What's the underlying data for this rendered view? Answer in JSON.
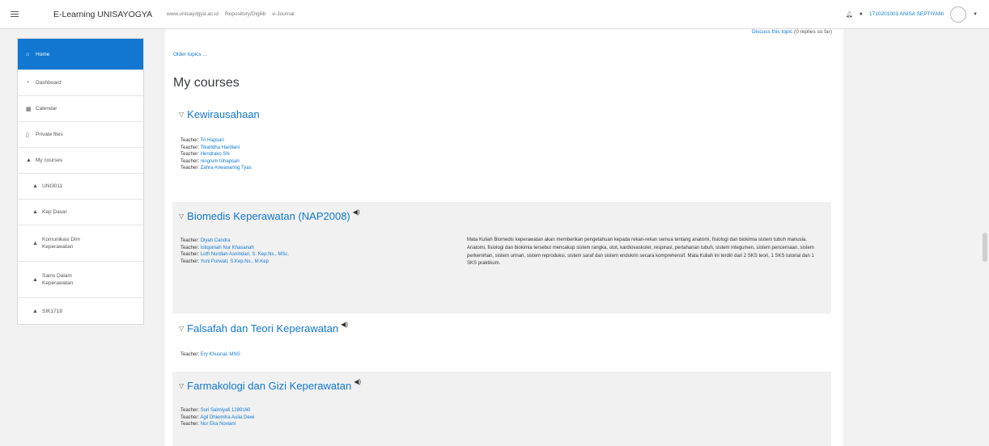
{
  "navbar": {
    "brand": "E-Learning UNISAYOGYA",
    "links": [
      "www.unisayogya.ac.id",
      "Repository/Digilib",
      "e-Journal"
    ],
    "user": "1710201001 ANISA SEPTIYANI"
  },
  "sidebar": {
    "items": [
      {
        "icon": "home-icon",
        "glyph": "⌂",
        "label": "Home",
        "active": true,
        "indent": false
      },
      {
        "icon": "dashboard-icon",
        "glyph": "◔",
        "label": "Dashboard",
        "active": false,
        "indent": false
      },
      {
        "icon": "calendar-icon",
        "glyph": "▦",
        "label": "Calendar",
        "active": false,
        "indent": false
      },
      {
        "icon": "file-icon",
        "glyph": "▯",
        "label": "Private files",
        "active": false,
        "indent": false
      },
      {
        "icon": "graduation-cap-icon",
        "glyph": "▲",
        "label": "My courses",
        "active": false,
        "indent": false
      },
      {
        "icon": "graduation-cap-icon",
        "glyph": "▲",
        "label": "UNI3011",
        "active": false,
        "indent": true
      },
      {
        "icon": "graduation-cap-icon",
        "glyph": "▲",
        "label": "Kep Dasar",
        "active": false,
        "indent": true
      },
      {
        "icon": "graduation-cap-icon",
        "glyph": "▲",
        "label": "Komunikasi Dlm Keperawatan",
        "active": false,
        "indent": true
      },
      {
        "icon": "graduation-cap-icon",
        "glyph": "▲",
        "label": "Sains Dalam Keperawatan",
        "active": false,
        "indent": true
      },
      {
        "icon": "graduation-cap-icon",
        "glyph": "▲",
        "label": "SIK1718",
        "active": false,
        "indent": true
      }
    ]
  },
  "main": {
    "discuss_link": "Discuss this topic",
    "discuss_count": "(0 replies so far)",
    "older_topics": "Older topics ...",
    "heading": "My courses",
    "teacher_label": "Teacher:",
    "courses": [
      {
        "title": "Kewirausahaan",
        "has_summary": false,
        "teachers": [
          "Tri Hapsari",
          "Tikaridha Hardiani",
          "Hendrako SN",
          "ningrum trihapsari",
          "Zahra Anwanaring Tyas"
        ]
      },
      {
        "title": "Biomedis Keperawatan (NAP2008)",
        "has_summary": true,
        "teachers": [
          "Diyah Candra",
          "Istiqomah Nur Khasanah",
          "Lutfi Nurdian Asnindari, S. Kep.Ns., MSc.",
          "Yuni Purwati, S.Kep.Ns., M.Kep"
        ],
        "summary": "Mata Kuliah Biomedis keperawatan akan memberikan pengetahuan kepada rekan-rekan semua tentang anatomi, fisiologi dan biokimia sistem tubuh manusia. Anatomi, fisiologi dan biokimia tersebut mencakup sistem rangka, otot, kardiovaskuler, respirasi, pertahanan tubuh, sistem integumen, sistem pencernaan, sistem perkemihan, sistem urinari, sistem reproduksi, sistem saraf dan sistem endokrin secara komprehensif.  Mata Kuliah ini terdiri dari 2 SKS teori, 1 SKS tutorial dan 1 SKS praktikum."
      },
      {
        "title": "Falsafah dan Teori Keperawatan",
        "has_summary": true,
        "teachers": [
          "Ery Khusnal, MNS"
        ]
      },
      {
        "title": "Farmakologi dan Gizi Keperawatan",
        "has_summary": true,
        "teachers": [
          "Suri Salmiyati 1289160",
          "Agil Dhiemitra Aulia Dewi",
          "Nur Eka Noviani"
        ]
      }
    ]
  }
}
